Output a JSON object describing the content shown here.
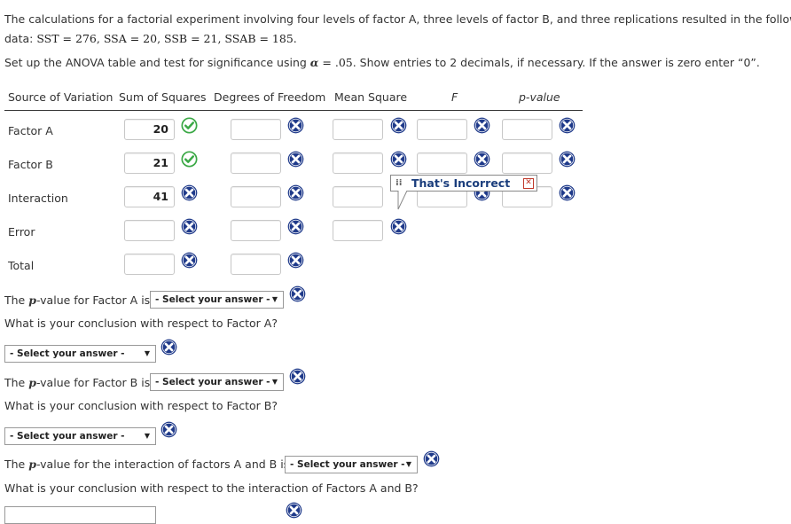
{
  "problem": {
    "line1": "The calculations for a factorial experiment involving four levels of factor A, three levels of factor B, and three replications resulted in the following",
    "line2_prefix": "data: ",
    "line2_math": "SST = 276, SSA = 20, SSB = 21, SSAB = 185.",
    "instr_prefix": "Set up the ANOVA table and test for significance using ",
    "instr_alpha": "α",
    "instr_alpha_value": " = .05",
    "instr_suffix": ". Show entries to 2 decimals, if necessary. If the answer is zero enter “0”."
  },
  "table": {
    "headers": [
      "Source of Variation",
      "Sum of Squares",
      "Degrees of Freedom",
      "Mean Square",
      "F",
      "p-value"
    ],
    "rows": [
      {
        "label": "Factor A",
        "ss": "20",
        "ss_status": "correct",
        "df": "",
        "ms": "",
        "f": "",
        "p": ""
      },
      {
        "label": "Factor B",
        "ss": "21",
        "ss_status": "correct",
        "df": "",
        "ms": "",
        "f": "",
        "p": ""
      },
      {
        "label": "Interaction",
        "ss": "41",
        "ss_status": "incorrect",
        "df": "",
        "ms": "",
        "f": "",
        "p": ""
      },
      {
        "label": "Error",
        "ss": "",
        "ss_status": "incorrect",
        "df": "",
        "ms": ""
      },
      {
        "label": "Total",
        "ss": "",
        "ss_status": "incorrect",
        "df": ""
      }
    ]
  },
  "tooltip": {
    "text": "That's Incorrect"
  },
  "questions": {
    "pA_prefix": "The ",
    "p_letter": "p",
    "pA_suffix": "-value for Factor A is",
    "conclA": "What is your conclusion with respect to Factor A?",
    "pB_suffix": "-value for Factor B is",
    "conclB": "What is your conclusion with respect to Factor B?",
    "pAB_suffix": "-value for the interaction of factors A and B is",
    "conclAB": "What is your conclusion with respect to the interaction of Factors A and B?",
    "select_placeholder": "- Select your answer -",
    "arrow": "▼"
  },
  "colors": {
    "correct": "#3aa845",
    "incorrect": "#1f3a8a",
    "tooltip_text": "#1a3d7c"
  }
}
